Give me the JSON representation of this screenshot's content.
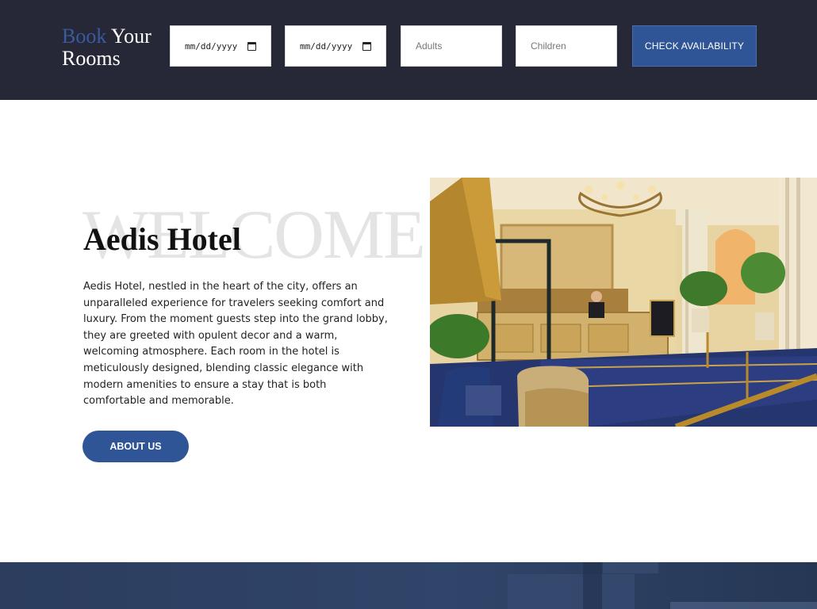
{
  "booking": {
    "title_accent": "Book",
    "title_rest": "Your",
    "title_line2": "Rooms",
    "checkin_value": "mm/dd/yyyy",
    "checkout_value": "mm/dd/yyyy",
    "adults_placeholder": "Adults",
    "children_placeholder": "Children",
    "check_button": "CHECK AVAILABILITY"
  },
  "welcome": {
    "watermark": "WELCOME",
    "hotel_name": "Aedis Hotel",
    "description": "Aedis Hotel, nestled in the heart of the city, offers an unparalleled experience for travelers seeking comfort and luxury. From the moment guests step into the grand lobby, they are greeted with opulent decor and a warm, welcoming atmosphere. Each room in the hotel is meticulously designed, blending classic elegance with modern amenities to ensure a stay that is both comfortable and memorable.",
    "about_button": "ABOUT US"
  },
  "icons": [
    "calendar-icon"
  ],
  "colors": {
    "header_bg": "#262837",
    "accent": "#2f5596",
    "watermark": "#e4e4e4"
  }
}
